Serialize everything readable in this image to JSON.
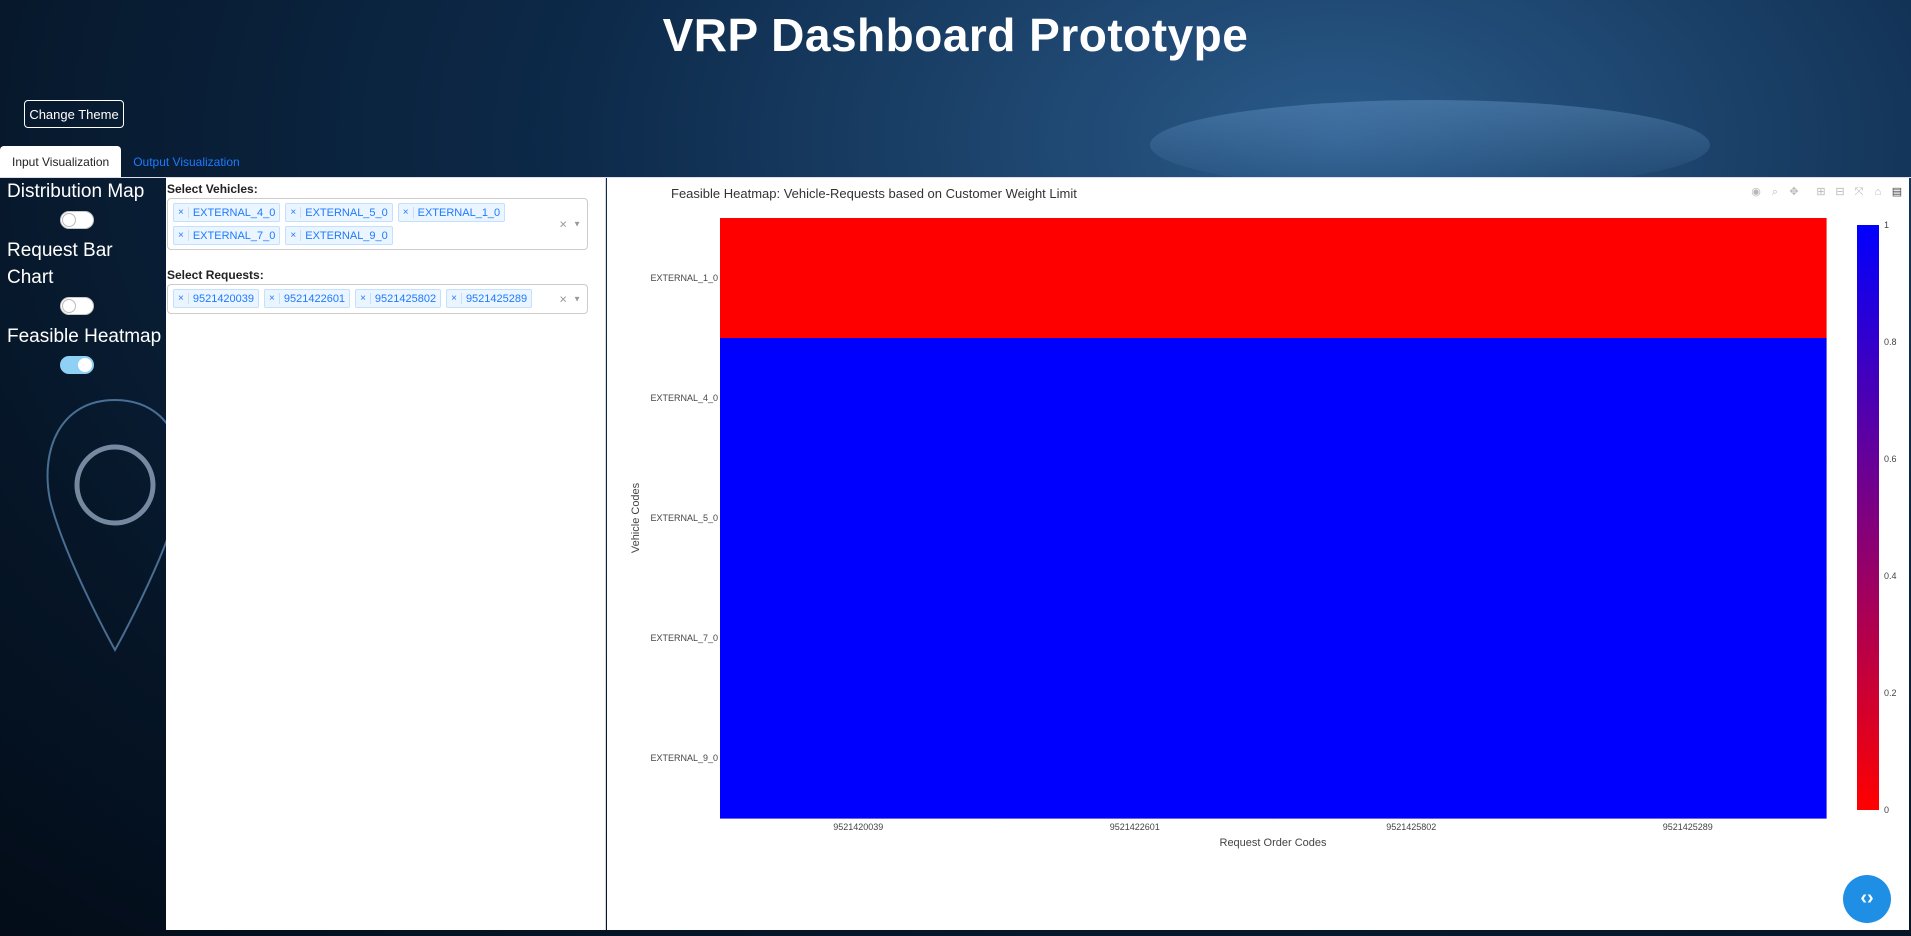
{
  "header": {
    "title": "VRP Dashboard Prototype"
  },
  "theme_button": {
    "label": "Change Theme"
  },
  "tabs": [
    {
      "label": "Input Visualization",
      "active": true
    },
    {
      "label": "Output Visualization",
      "active": false
    }
  ],
  "sidebar": {
    "items": [
      {
        "label": "Distribution Map",
        "on": false
      },
      {
        "label": "Request Bar Chart",
        "on": false
      },
      {
        "label": "Feasible Heatmap",
        "on": true
      }
    ]
  },
  "filters": {
    "vehicles": {
      "label": "Select Vehicles:",
      "selected": [
        "EXTERNAL_4_0",
        "EXTERNAL_5_0",
        "EXTERNAL_1_0",
        "EXTERNAL_7_0",
        "EXTERNAL_9_0"
      ]
    },
    "requests": {
      "label": "Select Requests:",
      "selected": [
        "9521420039",
        "9521422601",
        "9521425802",
        "9521425289"
      ]
    }
  },
  "modebar_icons": [
    "camera-icon",
    "zoom-icon",
    "pan-icon",
    "zoom-in-icon",
    "zoom-out-icon",
    "autoscale-icon",
    "reset-axes-icon",
    "plotly-logo-icon"
  ],
  "chart_data": {
    "type": "heatmap",
    "title": "Feasible Heatmap: Vehicle-Requests based on Customer Weight Limit",
    "xlabel": "Request Order Codes",
    "ylabel": "Vehicle Codes",
    "x": [
      "9521420039",
      "9521422601",
      "9521425802",
      "9521425289"
    ],
    "y": [
      "EXTERNAL_1_0",
      "EXTERNAL_4_0",
      "EXTERNAL_5_0",
      "EXTERNAL_7_0",
      "EXTERNAL_9_0"
    ],
    "z": [
      [
        0,
        0,
        0,
        0
      ],
      [
        1,
        1,
        1,
        1
      ],
      [
        1,
        1,
        1,
        1
      ],
      [
        1,
        1,
        1,
        1
      ],
      [
        1,
        1,
        1,
        1
      ]
    ],
    "zlim": [
      0,
      1
    ],
    "colorscale": {
      "low": "#ff0000",
      "high": "#0000ff"
    },
    "colorbar_ticks": [
      "0",
      "0.2",
      "0.4",
      "0.6",
      "0.8",
      "1"
    ]
  }
}
